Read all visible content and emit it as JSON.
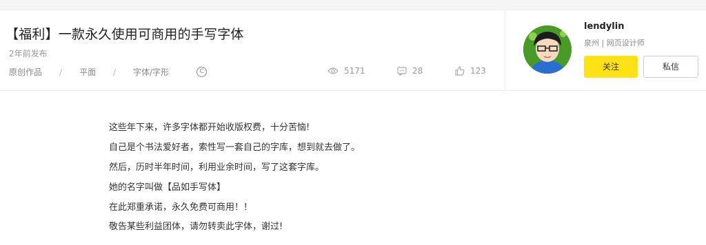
{
  "article": {
    "title": "【福利】一款永久使用可商用的手写字体",
    "published": "2年前发布",
    "breadcrumbs": [
      "原创作品",
      "平面",
      "字体/字形"
    ],
    "license_icon": "copyright-icon",
    "license_glyph": "C",
    "stats": {
      "views": "5171",
      "comments": "28",
      "likes": "123"
    }
  },
  "author": {
    "name": "lendylin",
    "info": "泉州 | 网页设计师",
    "follow_label": "关注",
    "message_label": "私信"
  },
  "body": {
    "lines": [
      "这些年下来，许多字体都开始收版权费，十分苦恼!",
      "自己是个书法爱好者，索性写一套自己的字库，想到就去做了。",
      "然后，历时半年时间，利用业余时间，写了这套字库。",
      "她的名字叫做【品如手写体】",
      "在此郑重承诺，永久免费可商用！！",
      "敬告某些利益团体，请勿转卖此字体，谢过!"
    ]
  },
  "colors": {
    "follow_button": "#ffe118",
    "stat_icon": "#aaaaaa"
  }
}
